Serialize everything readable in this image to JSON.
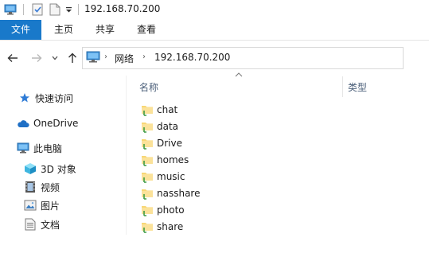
{
  "window": {
    "title": "192.168.70.200"
  },
  "quick_access_toolbar": {
    "icons": [
      "computer-icon",
      "properties-check-icon",
      "new-folder-icon",
      "customize-dropdown-icon"
    ]
  },
  "ribbon": {
    "tabs": [
      {
        "label": "文件",
        "active": true
      },
      {
        "label": "主页"
      },
      {
        "label": "共享"
      },
      {
        "label": "查看"
      }
    ],
    "file_tab_color": "#1979ca"
  },
  "navigation": {
    "back": "back-arrow-icon",
    "forward": "forward-arrow-icon",
    "recent": "recent-locations-dropdown-icon",
    "up": "up-arrow-icon"
  },
  "address": {
    "crumbs": [
      "网络",
      "192.168.70.200"
    ]
  },
  "sidebar": {
    "items": [
      {
        "label": "快速访问",
        "icon": "star-icon"
      },
      {
        "label": "OneDrive",
        "icon": "cloud-icon"
      },
      {
        "label": "此电脑",
        "icon": "computer-icon"
      },
      {
        "label": "3D 对象",
        "icon": "3d-objects-icon"
      },
      {
        "label": "视频",
        "icon": "video-icon"
      },
      {
        "label": "图片",
        "icon": "pictures-icon"
      },
      {
        "label": "文档",
        "icon": "documents-icon"
      }
    ]
  },
  "content": {
    "columns": {
      "name": "名称",
      "type": "类型"
    },
    "items": [
      {
        "name": "chat"
      },
      {
        "name": "data"
      },
      {
        "name": "Drive"
      },
      {
        "name": "homes"
      },
      {
        "name": "music"
      },
      {
        "name": "nasshare"
      },
      {
        "name": "photo"
      },
      {
        "name": "share"
      }
    ],
    "item_icon": "shared-folder-icon"
  }
}
